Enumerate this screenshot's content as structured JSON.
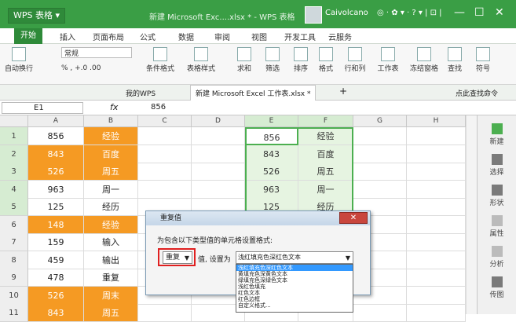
{
  "app": {
    "name": "WPS 表格",
    "doc_title": "新建 Microsoft Exc....xlsx * - WPS 表格",
    "user": "Caivolcano",
    "tb_icons": "◎ · ✿ ▾ · ? ▾ |  ⊡  |",
    "min": "—",
    "max": "☐",
    "close": "✕"
  },
  "menu": [
    "开始",
    "插入",
    "页面布局",
    "公式",
    "数据",
    "审阅",
    "视图",
    "开发工具",
    "云服务"
  ],
  "ribbon": {
    "wrap": "自动换行",
    "format": "常规",
    "pct": "% , +.0 .00",
    "cond": "条件格式",
    "tblstyle": "表格样式",
    "sum": "求和",
    "filter": "筛选",
    "sort": "排序",
    "fmt": "格式",
    "rowcol": "行和列",
    "sheet": "工作表",
    "freeze": "冻结窗格",
    "find": "查找",
    "symbol": "符号"
  },
  "tabs": {
    "mywps": "我的WPS",
    "file": "新建 Microsoft Excel 工作表.xlsx *",
    "plus": "+",
    "search": "点此查找命令"
  },
  "formula": {
    "cell": "E1",
    "fx": "fx",
    "value": "856"
  },
  "columns": [
    "A",
    "B",
    "C",
    "D",
    "E",
    "F",
    "G",
    "H"
  ],
  "rows": [
    {
      "n": "1",
      "a": "856",
      "b": "经验",
      "e": "856",
      "f": "经验"
    },
    {
      "n": "2",
      "a": "843",
      "b": "百度",
      "e": "843",
      "f": "百度"
    },
    {
      "n": "3",
      "a": "526",
      "b": "周五",
      "e": "526",
      "f": "周五"
    },
    {
      "n": "4",
      "a": "963",
      "b": "周一",
      "e": "963",
      "f": "周一"
    },
    {
      "n": "5",
      "a": "125",
      "b": "经历",
      "e": "125",
      "f": "经历"
    },
    {
      "n": "6",
      "a": "148",
      "b": "经验",
      "e": "",
      "f": ""
    },
    {
      "n": "7",
      "a": "159",
      "b": "输入",
      "e": "",
      "f": ""
    },
    {
      "n": "8",
      "a": "459",
      "b": "输出",
      "e": "",
      "f": ""
    },
    {
      "n": "9",
      "a": "478",
      "b": "重复",
      "e": "",
      "f": ""
    },
    {
      "n": "10",
      "a": "526",
      "b": "周末",
      "e": "",
      "f": ""
    },
    {
      "n": "11",
      "a": "843",
      "b": "周五",
      "e": "",
      "f": ""
    }
  ],
  "side": [
    "新建",
    "选择",
    "形状",
    "属性",
    "分析",
    "传图"
  ],
  "dialog": {
    "title": "重复值",
    "desc": "为包含以下类型值的单元格设置格式:",
    "kind": "重复",
    "mid": "值, 设置为",
    "format": "浅红填充色深红色文本",
    "close": "✕",
    "options": [
      "浅红填充色深红色文本",
      "黄填充色深黄色文本",
      "绿填充色深绿色文本",
      "浅红色填充",
      "红色文本",
      "红色边框",
      "自定义格式..."
    ]
  }
}
